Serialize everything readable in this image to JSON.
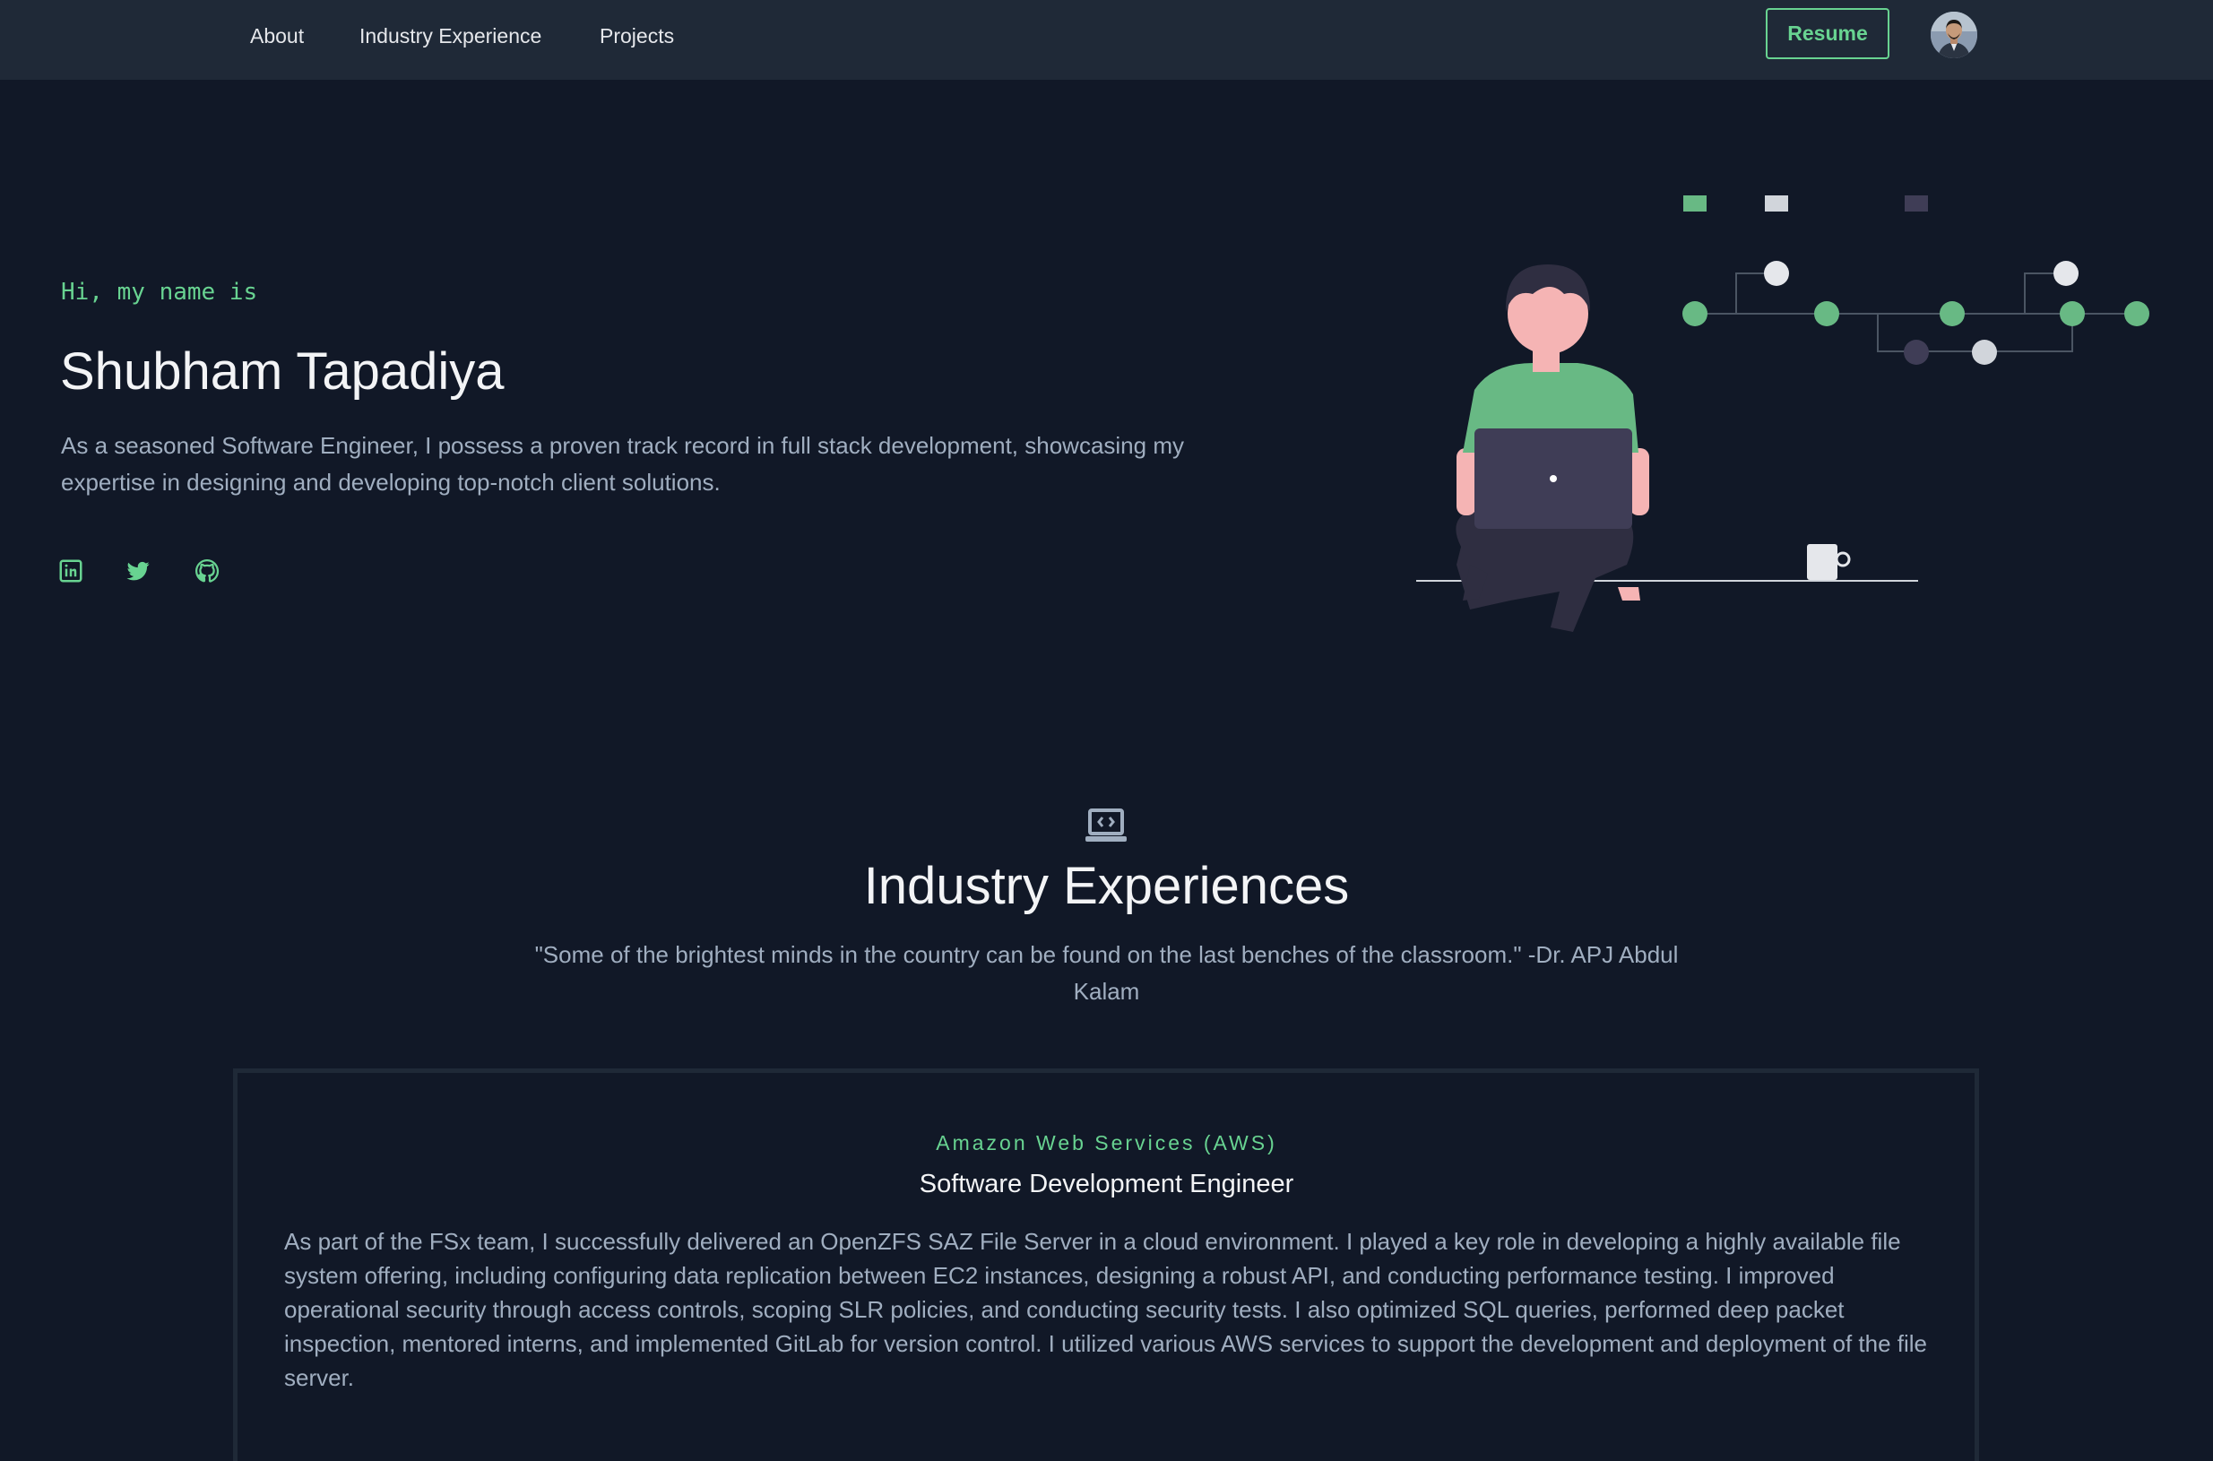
{
  "nav": {
    "links": [
      "About",
      "Industry Experience",
      "Projects"
    ],
    "resume_label": "Resume",
    "avatar_icon": "profile-photo"
  },
  "hero": {
    "greeting": "Hi, my name is",
    "name": "Shubham Tapadiya",
    "description": "As a seasoned Software Engineer, I possess a proven track record in full stack development, showcasing my expertise in designing and developing top-notch client solutions.",
    "social_icons": [
      "linkedin-icon",
      "twitter-icon",
      "github-icon"
    ]
  },
  "experience": {
    "icon": "laptop-code-icon",
    "title": "Industry Experiences",
    "quote": "\"Some of the brightest minds in the country can be found on the last benches of the classroom.\" -Dr. APJ Abdul Kalam",
    "jobs": [
      {
        "company": "Amazon Web Services (AWS)",
        "role": "Software Development Engineer",
        "description": "As part of the FSx team, I successfully delivered an OpenZFS SAZ File Server in a cloud environment. I played a key role in developing a highly available file system offering, including configuring data replication between EC2 instances, designing a robust API, and conducting performance testing. I improved operational security through access controls, scoping SLR policies, and conducting security tests. I also optimized SQL queries, performed deep packet inspection, mentored interns, and implemented GitLab for version control. I utilized various AWS services to support the development and deployment of the file server."
      }
    ]
  },
  "colors": {
    "background": "#111827",
    "nav_background": "#1f2937",
    "accent": "#68d391",
    "text_muted": "#a0aec0",
    "heading": "#f3f4f6"
  }
}
